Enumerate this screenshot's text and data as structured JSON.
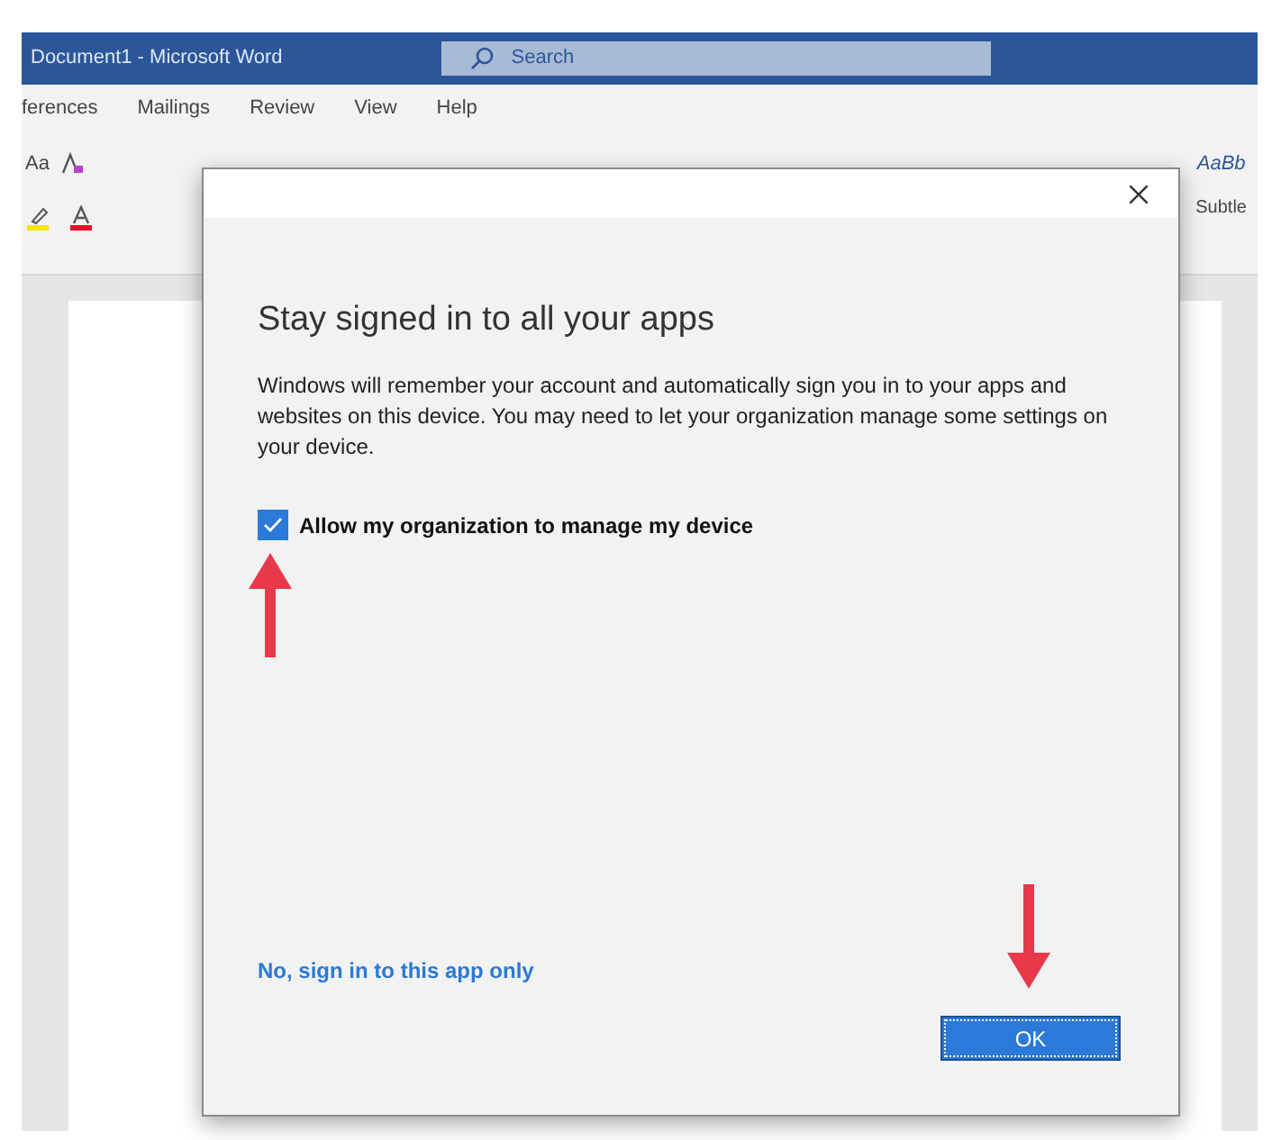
{
  "window": {
    "title": "Document1  -  Microsoft Word"
  },
  "search": {
    "placeholder": "Search"
  },
  "ribbon_tabs": [
    {
      "label": "ferences"
    },
    {
      "label": "Mailings"
    },
    {
      "label": "Review"
    },
    {
      "label": "View"
    },
    {
      "label": "Help"
    }
  ],
  "font_group": {
    "change_case": "Aa"
  },
  "styles_gallery": {
    "sample": "AaBb",
    "name": "Subtle"
  },
  "dialog": {
    "title": "Stay signed in to all your apps",
    "body": "Windows will remember your account and automatically sign you in to your apps and websites on this device. You may need to let your organization manage some settings on your device.",
    "checkbox": {
      "label": "Allow my organization to manage my device",
      "checked": true
    },
    "link": "No, sign in to this app only",
    "ok_button": "OK"
  }
}
